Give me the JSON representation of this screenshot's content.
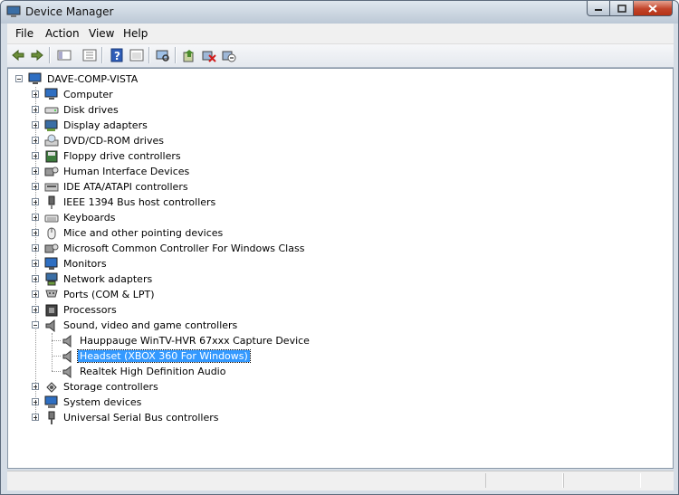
{
  "window": {
    "title": "Device Manager"
  },
  "menu": [
    "File",
    "Action",
    "View",
    "Help"
  ],
  "toolbar": [
    "back-icon",
    "forward-icon",
    "up-level-icon",
    "show-hide-tree-icon",
    "help-icon",
    "properties-icon",
    "scan-hardware-icon",
    "update-driver-icon",
    "disable-device-icon",
    "uninstall-device-icon"
  ],
  "tree": {
    "root": "DAVE-COMP-VISTA",
    "categories": [
      {
        "label": "Computer",
        "icon": "computer-icon"
      },
      {
        "label": "Disk drives",
        "icon": "disk-drive-icon"
      },
      {
        "label": "Display adapters",
        "icon": "display-adapter-icon"
      },
      {
        "label": "DVD/CD-ROM drives",
        "icon": "dvd-drive-icon"
      },
      {
        "label": "Floppy drive controllers",
        "icon": "floppy-controller-icon"
      },
      {
        "label": "Human Interface Devices",
        "icon": "hid-icon"
      },
      {
        "label": "IDE ATA/ATAPI controllers",
        "icon": "ide-controller-icon"
      },
      {
        "label": "IEEE 1394 Bus host controllers",
        "icon": "ieee1394-icon"
      },
      {
        "label": "Keyboards",
        "icon": "keyboard-icon"
      },
      {
        "label": "Mice and other pointing devices",
        "icon": "mouse-icon"
      },
      {
        "label": "Microsoft Common Controller For Windows Class",
        "icon": "controller-class-icon"
      },
      {
        "label": "Monitors",
        "icon": "monitor-icon"
      },
      {
        "label": "Network adapters",
        "icon": "network-adapter-icon"
      },
      {
        "label": "Ports (COM & LPT)",
        "icon": "port-icon"
      },
      {
        "label": "Processors",
        "icon": "processor-icon"
      },
      {
        "label": "Sound, video and game controllers",
        "icon": "sound-icon"
      },
      {
        "label": "Storage controllers",
        "icon": "storage-controller-icon"
      },
      {
        "label": "System devices",
        "icon": "system-devices-icon"
      },
      {
        "label": "Universal Serial Bus controllers",
        "icon": "usb-icon"
      }
    ],
    "sound_children": [
      {
        "label": "Hauppauge WinTV-HVR 67xxx Capture Device",
        "selected": false
      },
      {
        "label": "Headset (XBOX 360 For Windows)",
        "selected": true
      },
      {
        "label": "Realtek High Definition Audio",
        "selected": false
      }
    ]
  },
  "colors": {
    "selection": "#3399ff",
    "window_frame": "#5d6b7c"
  }
}
